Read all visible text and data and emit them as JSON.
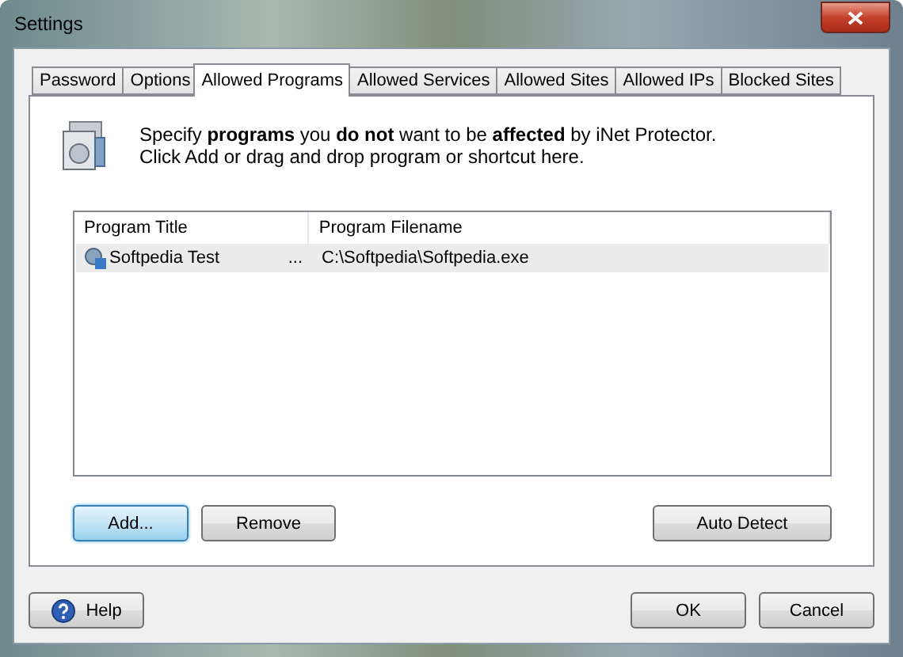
{
  "window": {
    "title": "Settings"
  },
  "tabs": [
    {
      "label": "Password",
      "selected": false
    },
    {
      "label": "Options",
      "selected": false
    },
    {
      "label": "Allowed Programs",
      "selected": true
    },
    {
      "label": "Allowed Services",
      "selected": false
    },
    {
      "label": "Allowed Sites",
      "selected": false
    },
    {
      "label": "Allowed IPs",
      "selected": false
    },
    {
      "label": "Blocked Sites",
      "selected": false
    }
  ],
  "intro": [
    "Specify **programs** you **do not** want to be **affected** by iNet Protector.",
    "Click Add or drag and drop program or shortcut here."
  ],
  "table": {
    "columns": [
      "Program Title",
      "Program Filename"
    ],
    "rows": [
      {
        "title": "Softpedia Test",
        "ellipsis": "...",
        "filename": "C:\\Softpedia\\Softpedia.exe",
        "selected": true
      }
    ]
  },
  "list_buttons": [
    {
      "label": "Add...",
      "focused": true
    },
    {
      "label": "Remove",
      "focused": false
    }
  ],
  "detect_button": {
    "label": "Auto Detect",
    "focused": false
  },
  "help_button": {
    "label": "Help"
  },
  "dialog_buttons": [
    {
      "label": "OK",
      "focused": false
    },
    {
      "label": "Cancel",
      "focused": false
    }
  ]
}
